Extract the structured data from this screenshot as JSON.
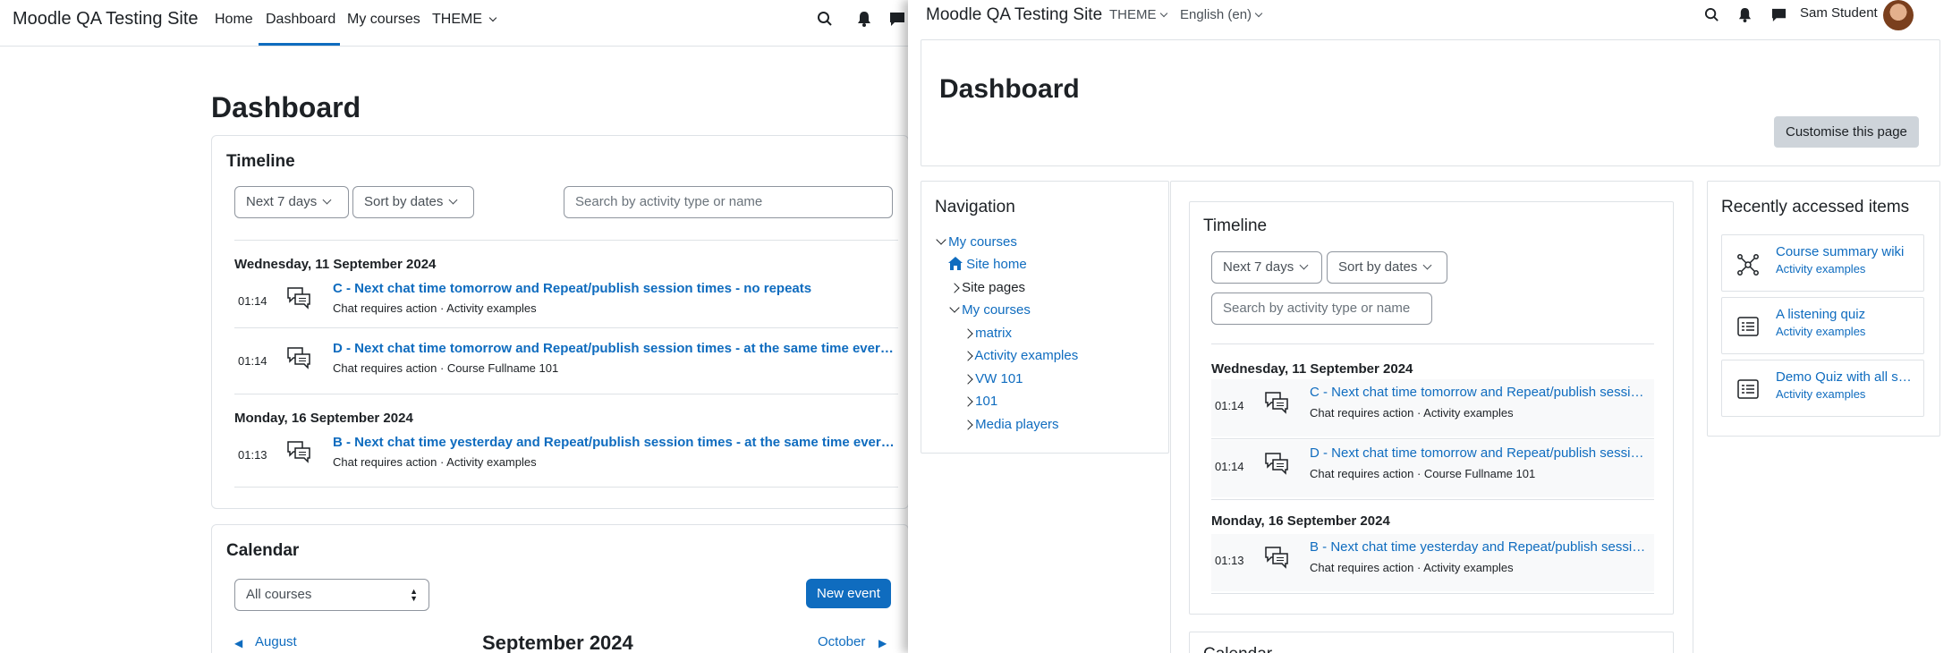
{
  "left": {
    "site_name": "Moodle QA Testing Site",
    "nav": {
      "home": "Home",
      "dashboard": "Dashboard",
      "my_courses": "My courses",
      "theme": "THEME"
    },
    "page_title": "Dashboard",
    "timeline": {
      "title": "Timeline",
      "filter_label": "Next 7 days",
      "sort_label": "Sort by dates",
      "search_placeholder": "Search by activity type or name",
      "days": [
        {
          "date": "Wednesday, 11 September 2024",
          "events": [
            {
              "time": "01:14",
              "title": "C - Next chat time tomorrow and Repeat/publish session times - no repeats",
              "subtitle": "Chat requires action · Activity examples"
            },
            {
              "time": "01:14",
              "title": "D - Next chat time tomorrow and Repeat/publish session times - at the same time every day",
              "subtitle": "Chat requires action · Course Fullname 101"
            }
          ]
        },
        {
          "date": "Monday, 16 September 2024",
          "events": [
            {
              "time": "01:13",
              "title": "B - Next chat time yesterday and Repeat/publish session times - at the same time every day",
              "subtitle": "Chat requires action · Activity examples"
            }
          ]
        }
      ]
    },
    "calendar": {
      "title": "Calendar",
      "course_filter": "All courses",
      "new_event": "New event",
      "prev_month": "August",
      "current_month": "September 2024",
      "next_month": "October"
    }
  },
  "right": {
    "site_name": "Moodle QA Testing Site",
    "theme_menu": "THEME",
    "language_menu": "English (en)",
    "user_name": "Sam Student",
    "page_title": "Dashboard",
    "customise_button": "Customise this page",
    "navigation": {
      "title": "Navigation",
      "items": [
        {
          "label": "My courses",
          "chevron": "down",
          "link": true
        },
        {
          "label": "Site home",
          "chevron": "home",
          "link": true
        },
        {
          "label": "Site pages",
          "chevron": "right",
          "link": false
        },
        {
          "label": "My courses",
          "chevron": "down",
          "link": true
        },
        {
          "label": "matrix",
          "chevron": "right",
          "link": true
        },
        {
          "label": "Activity examples",
          "chevron": "right",
          "link": true
        },
        {
          "label": "VW 101",
          "chevron": "right",
          "link": true
        },
        {
          "label": "101",
          "chevron": "right",
          "link": true
        },
        {
          "label": "Media players",
          "chevron": "right",
          "link": true
        }
      ]
    },
    "timeline": {
      "title": "Timeline",
      "filter_label": "Next 7 days",
      "sort_label": "Sort by dates",
      "search_placeholder": "Search by activity type or name",
      "days": [
        {
          "date": "Wednesday, 11 September 2024",
          "events": [
            {
              "time": "01:14",
              "title": "C - Next chat time tomorrow and Repeat/publish session times - no repeats",
              "subtitle": "Chat requires action · Activity examples"
            },
            {
              "time": "01:14",
              "title": "D - Next chat time tomorrow and Repeat/publish session times - at the same time every day",
              "subtitle": "Chat requires action · Course Fullname 101"
            }
          ]
        },
        {
          "date": "Monday, 16 September 2024",
          "events": [
            {
              "time": "01:13",
              "title": "B - Next chat time yesterday and Repeat/publish session times - at the same time every day",
              "subtitle": "Chat requires action · Activity examples"
            }
          ]
        }
      ]
    },
    "calendar_title": "Calendar",
    "recent": {
      "title": "Recently accessed items",
      "items": [
        {
          "name": "Course summary wiki",
          "course": "Activity examples",
          "icon": "wiki-icon"
        },
        {
          "name": "A listening quiz",
          "course": "Activity examples",
          "icon": "quiz-icon"
        },
        {
          "name": "Demo Quiz with all sorts of questions",
          "course": "Activity examples",
          "icon": "quiz-icon"
        }
      ]
    }
  },
  "colors": {
    "link": "#0f6cbf",
    "border": "#dee2e6",
    "text": "#1d2125",
    "muted": "#495057"
  }
}
